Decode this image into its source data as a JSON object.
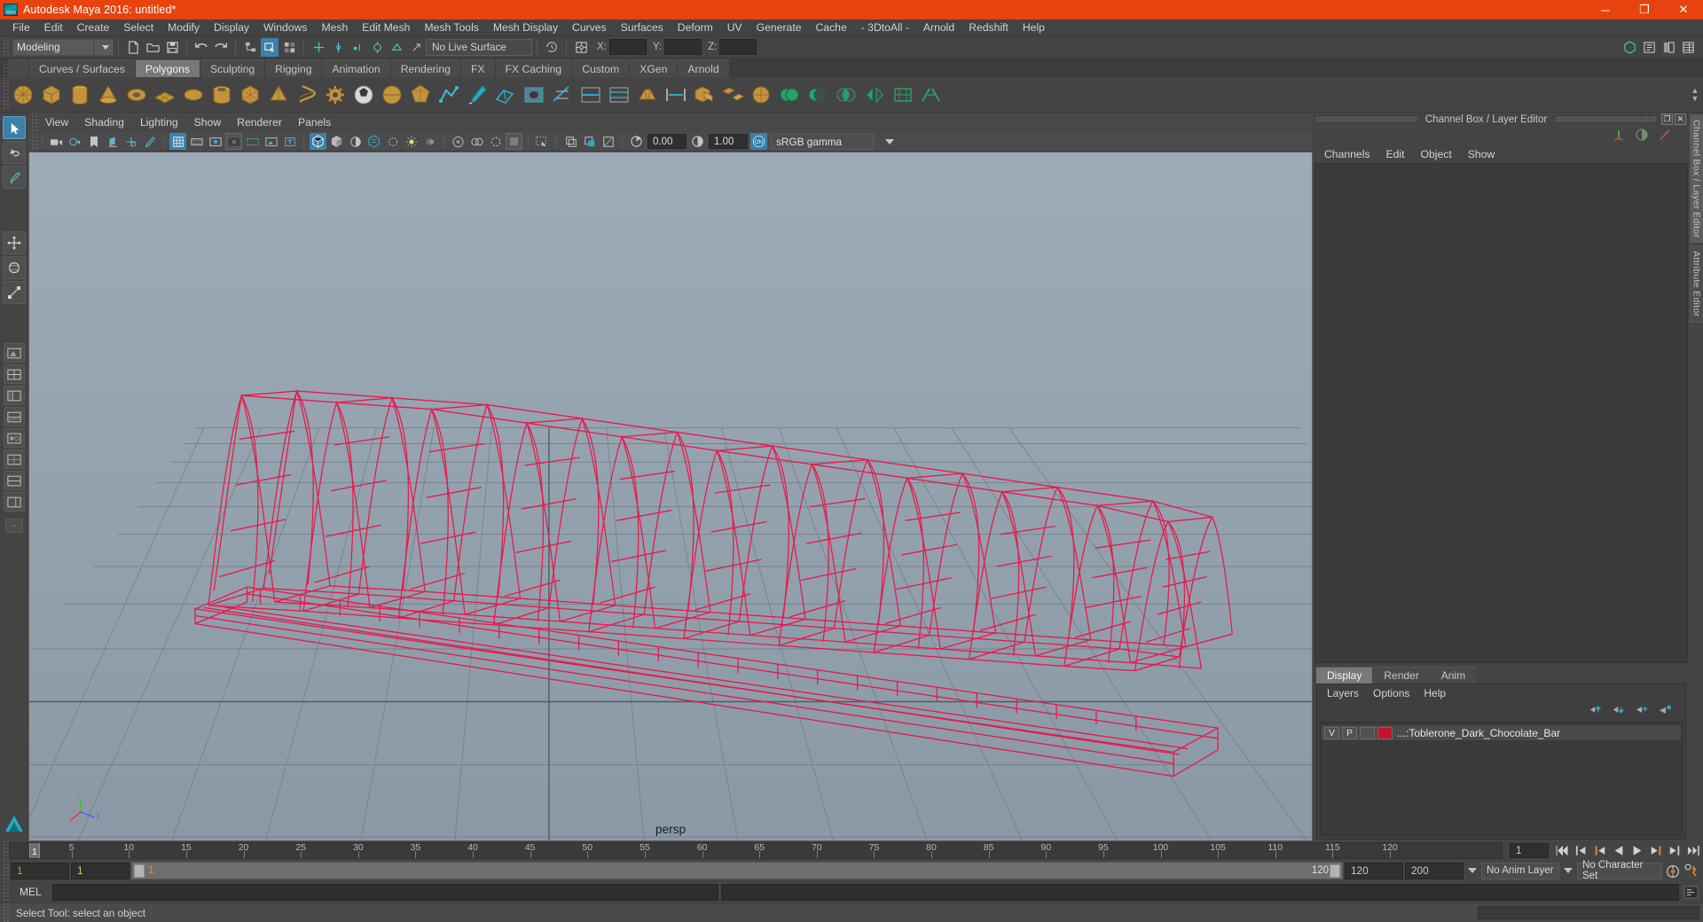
{
  "window": {
    "title": "Autodesk Maya 2016: untitled*",
    "logo_icon": "maya-logo-icon",
    "minimize_label": "─",
    "maximize_label": "❐",
    "close_label": "✕"
  },
  "menubar": {
    "items": [
      "File",
      "Edit",
      "Create",
      "Select",
      "Modify",
      "Display",
      "Windows",
      "Mesh",
      "Edit Mesh",
      "Mesh Tools",
      "Mesh Display",
      "Curves",
      "Surfaces",
      "Deform",
      "UV",
      "Generate",
      "Cache",
      "- 3DtoAll -",
      "Arnold",
      "Redshift",
      "Help"
    ]
  },
  "statusline": {
    "menuset": "Modeling",
    "live_surface": "No Live Surface",
    "coord_labels": {
      "x": "X:",
      "y": "Y:",
      "z": "Z:"
    },
    "coord_values": {
      "x": "",
      "y": "",
      "z": ""
    },
    "icons": [
      "new-scene-icon",
      "open-scene-icon",
      "save-scene-icon",
      "undo-icon",
      "redo-icon",
      "select-by-hierarchy-icon",
      "select-by-object-icon",
      "select-by-component-icon",
      "snap-to-grid-icon",
      "snap-to-curve-icon",
      "snap-to-point-icon",
      "snap-to-projected-center-icon",
      "snap-to-view-plane-icon",
      "make-live-icon",
      "show-manipulator-icon",
      "input-connections-icon",
      "output-connections-icon",
      "construction-history-icon",
      "render-current-frame-icon",
      "ipr-render-icon",
      "render-settings-icon",
      "outliner-icon",
      "attribute-editor-icon",
      "tool-settings-icon",
      "channel-box-icon"
    ]
  },
  "shelf": {
    "tabs": [
      "Curves / Surfaces",
      "Polygons",
      "Sculpting",
      "Rigging",
      "Animation",
      "Rendering",
      "FX",
      "FX Caching",
      "Custom",
      "XGen",
      "Arnold"
    ],
    "active_tab": "Polygons",
    "icons": [
      "poly-sphere-icon",
      "poly-cube-icon",
      "poly-cylinder-icon",
      "poly-cone-icon",
      "poly-torus-icon",
      "poly-plane-icon",
      "poly-disc-icon",
      "poly-pipe-icon",
      "poly-prism-icon",
      "poly-pyramid-icon",
      "poly-helix-icon",
      "poly-gear-icon",
      "poly-soccerball-icon",
      "poly-superellipse-icon",
      "poly-platonic-icon",
      "create-poly-icon",
      "sculpt-geometry-icon",
      "append-polygon-icon",
      "make-hole-icon",
      "multi-cut-icon",
      "insert-edge-loop-icon",
      "offset-edge-loop-icon",
      "bevel-icon",
      "bridge-icon",
      "combine-icon",
      "separate-icon",
      "smooth-icon",
      "booleans-union-icon",
      "booleans-difference-icon",
      "booleans-intersection-icon",
      "mirror-icon",
      "reduce-icon",
      "remesh-icon"
    ]
  },
  "toolbox": {
    "tools": [
      {
        "name": "select-tool",
        "selected": true
      },
      {
        "name": "lasso-select-tool",
        "selected": false
      },
      {
        "name": "paint-select-tool",
        "selected": false
      },
      {
        "name": "move-tool",
        "selected": false
      },
      {
        "name": "rotate-tool",
        "selected": false
      },
      {
        "name": "scale-tool",
        "selected": false
      }
    ],
    "layout_tools": [
      "single-perspective-view-icon",
      "four-view-layout-icon",
      "perspective-outliner-icon",
      "perspective-graph-icon",
      "hypershade-perspective-icon",
      "persp-uv-icon",
      "two-pane-stacked-icon",
      "outliner-persp-icon",
      "more-layouts-icon"
    ],
    "overflow_label": "·"
  },
  "viewport": {
    "menubar": [
      "View",
      "Shading",
      "Lighting",
      "Show",
      "Renderer",
      "Panels"
    ],
    "toolbar": {
      "exposure": "0.00",
      "gamma": "1.00",
      "color_management": "sRGB gamma",
      "icons": [
        "select-camera-icon",
        "camera-attributes-icon",
        "bookmark-icon",
        "image-plane-icon",
        "two-d-pan-zoom-icon",
        "grease-pencil-icon",
        "grid-toggle-icon",
        "film-gate-icon",
        "resolution-gate-icon",
        "gate-mask-icon",
        "film-origin-icon",
        "xray-joints-icon",
        "wireframe-on-shaded-icon",
        "smooth-shade-icon",
        "flat-shade-icon",
        "shaded-wireframe-icon",
        "textured-icon",
        "use-all-lights-icon",
        "shadows-icon",
        "screen-space-ao-icon",
        "motion-blur-icon",
        "multisample-aa-icon",
        "isolate-select-icon",
        "xray-icon",
        "xray-active-components-icon",
        "xray-joints-b-icon",
        "exposure-icon",
        "gamma-icon",
        "color-management-toggle-icon"
      ]
    },
    "camera_label": "persp",
    "gnomon": {
      "x": "x",
      "y": "y",
      "z": "z"
    },
    "mesh_color": "#e6194b",
    "grid_color": "#6f7b86",
    "bg_top": "#9aa7b4",
    "bg_bottom": "#8e9caa"
  },
  "channel_box": {
    "dock_title": "Channel Box / Layer Editor",
    "restore_label": "❐",
    "close_label": "✕",
    "menus": [
      "Channels",
      "Edit",
      "Object",
      "Show"
    ],
    "header_icons": [
      "transform-channels-icon",
      "shape-channels-icon",
      "output-channels-icon"
    ]
  },
  "layer_editor": {
    "tabs": [
      "Display",
      "Render",
      "Anim"
    ],
    "active_tab": "Display",
    "menus": [
      "Layers",
      "Options",
      "Help"
    ],
    "icons": [
      "move-layer-up-icon",
      "move-layer-down-icon",
      "new-layer-icon",
      "new-layer-from-selected-icon"
    ],
    "layers": [
      {
        "visibility": "V",
        "playback": "P",
        "shading": "",
        "color": "#c4112e",
        "name": "...:Toblerone_Dark_Chocolate_Bar"
      }
    ]
  },
  "right_vtabs": [
    {
      "label": "Channel Box / Layer Editor",
      "active": true
    },
    {
      "label": "Attribute Editor",
      "active": false
    }
  ],
  "timeline": {
    "ticks": [
      5,
      10,
      15,
      20,
      25,
      30,
      35,
      40,
      45,
      50,
      55,
      60,
      65,
      70,
      75,
      80,
      85,
      90,
      95,
      100,
      105,
      110,
      115,
      120
    ],
    "start": 1,
    "end": 120,
    "current_frame": "1",
    "current_marker_label": "1",
    "end_marker_label": "120",
    "key_field": "1",
    "playback_buttons": [
      "go-to-start-icon",
      "step-back-keyframe-icon",
      "step-back-frame-icon",
      "play-backwards-icon",
      "play-forwards-icon",
      "step-forward-frame-icon",
      "step-forward-keyframe-icon",
      "go-to-end-icon"
    ]
  },
  "range_slider": {
    "anim_start": "1",
    "range_start": "1",
    "bar_start_label": "1",
    "bar_end_label": "120",
    "range_end": "120",
    "anim_end": "200",
    "anim_layer": "No Anim Layer",
    "character_set": "No Character Set",
    "icons": [
      "auto-keyframe-icon",
      "animation-preferences-icon"
    ]
  },
  "command_line": {
    "label": "MEL",
    "input_value": "",
    "output_value": "",
    "script-editor_icon": "script-editor-icon"
  },
  "help_line": {
    "text": "Select Tool: select an object"
  }
}
